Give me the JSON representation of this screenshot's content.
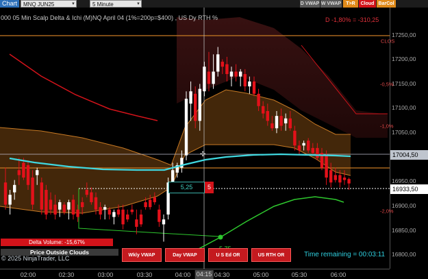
{
  "toolbar": {
    "chart_tab": "Chart",
    "instrument": "MNQ JUN25",
    "interval": "5 Minute",
    "buttons": [
      {
        "label": "D VWAP",
        "color": "#5a5a5a"
      },
      {
        "label": "W VWAP",
        "color": "#5a5a5a"
      },
      {
        "label": "T>R",
        "color": "#e08a1a"
      },
      {
        "label": "Cloud",
        "color": "#d3131a"
      },
      {
        "label": "BarCol",
        "color": "#e08a1a"
      }
    ]
  },
  "chart": {
    "title": "000 05 Min Scalp Delta & Ichi (M)NQ  April 04 (1%=200p=$400) , US Dy RTH %",
    "percent_summary": "D -1,80% = -310,25",
    "clos_label": "CLOS",
    "delta_volume": "Delta Volume: -15,67%",
    "price_outside_clouds": "Price Outside Clouds",
    "copyright": "© 2025 NinjaTrader, LLC",
    "vwap_buttons": [
      "Wkly VWAP",
      "Day VWAP",
      "U S Ed OR",
      "US RTH OR"
    ],
    "time_remaining": "Time remaining = 00:03:11",
    "cursor_value": "5,25",
    "cursor_count": "5",
    "green_line_label": "5,75",
    "colors": {
      "up": "#ffffff",
      "down": "#e3111a",
      "cloud": "#c87a24",
      "vwap": "#40d8e0",
      "ma_red": "#d3131a",
      "ma_green": "#2ec82e"
    }
  },
  "price_axis": {
    "labels": [
      "17250,00",
      "17200,00",
      "17150,00",
      "17100,00",
      "17050,00",
      "16950,00",
      "16900,00",
      "16850,00",
      "16800,00"
    ],
    "current_price": "16933,50",
    "cloud_price": "17004,50",
    "pct_labels": [
      "-0,5%",
      "-1,0%",
      "-2,0%"
    ]
  },
  "time_axis": {
    "labels": [
      "02:00",
      "02:30",
      "03:00",
      "03:30",
      "04:00",
      "04:30",
      "05:00",
      "05:30",
      "06:00"
    ],
    "cursor_time": "04:15"
  },
  "chart_data": {
    "type": "candlestick",
    "price_ylim": [
      16760,
      17290
    ],
    "candles": [
      {
        "o": 16935,
        "h": 16965,
        "l": 16880,
        "c": 16890
      },
      {
        "o": 16890,
        "h": 16920,
        "l": 16870,
        "c": 16910
      },
      {
        "o": 16915,
        "h": 16940,
        "l": 16900,
        "c": 16930
      },
      {
        "o": 16960,
        "h": 16985,
        "l": 16930,
        "c": 16950
      },
      {
        "o": 16975,
        "h": 16985,
        "l": 16940,
        "c": 16945
      },
      {
        "o": 16970,
        "h": 16980,
        "l": 16920,
        "c": 16930
      },
      {
        "o": 16945,
        "h": 16960,
        "l": 16880,
        "c": 16890
      },
      {
        "o": 16950,
        "h": 16965,
        "l": 16930,
        "c": 16960
      },
      {
        "o": 16935,
        "h": 16945,
        "l": 16870,
        "c": 16880
      },
      {
        "o": 16920,
        "h": 16930,
        "l": 16860,
        "c": 16870
      },
      {
        "o": 16900,
        "h": 16915,
        "l": 16870,
        "c": 16880
      },
      {
        "o": 16890,
        "h": 16910,
        "l": 16860,
        "c": 16870
      },
      {
        "o": 16880,
        "h": 16900,
        "l": 16865,
        "c": 16895
      },
      {
        "o": 16890,
        "h": 16895,
        "l": 16870,
        "c": 16875
      },
      {
        "o": 16880,
        "h": 16900,
        "l": 16860,
        "c": 16895
      },
      {
        "o": 16900,
        "h": 16910,
        "l": 16860,
        "c": 16870
      },
      {
        "o": 16880,
        "h": 16890,
        "l": 16855,
        "c": 16865
      },
      {
        "o": 16895,
        "h": 16905,
        "l": 16870,
        "c": 16885
      },
      {
        "o": 16920,
        "h": 16935,
        "l": 16905,
        "c": 16910
      },
      {
        "o": 16915,
        "h": 16925,
        "l": 16890,
        "c": 16895
      },
      {
        "o": 16905,
        "h": 16915,
        "l": 16870,
        "c": 16880
      },
      {
        "o": 16885,
        "h": 16895,
        "l": 16860,
        "c": 16870
      },
      {
        "o": 16880,
        "h": 16890,
        "l": 16860,
        "c": 16885
      },
      {
        "o": 16880,
        "h": 16885,
        "l": 16860,
        "c": 16870
      },
      {
        "o": 16865,
        "h": 16880,
        "l": 16850,
        "c": 16875
      },
      {
        "o": 16880,
        "h": 16890,
        "l": 16865,
        "c": 16870
      },
      {
        "o": 16880,
        "h": 16890,
        "l": 16840,
        "c": 16850
      },
      {
        "o": 16870,
        "h": 16880,
        "l": 16855,
        "c": 16860
      },
      {
        "o": 16880,
        "h": 16890,
        "l": 16870,
        "c": 16875
      },
      {
        "o": 16860,
        "h": 16880,
        "l": 16830,
        "c": 16845
      },
      {
        "o": 16870,
        "h": 16880,
        "l": 16845,
        "c": 16850
      },
      {
        "o": 16895,
        "h": 16905,
        "l": 16880,
        "c": 16885
      },
      {
        "o": 16900,
        "h": 16910,
        "l": 16880,
        "c": 16885
      },
      {
        "o": 16905,
        "h": 16915,
        "l": 16890,
        "c": 16895
      },
      {
        "o": 16880,
        "h": 16890,
        "l": 16845,
        "c": 16855
      },
      {
        "o": 16850,
        "h": 16870,
        "l": 16815,
        "c": 16860
      },
      {
        "o": 16870,
        "h": 16945,
        "l": 16860,
        "c": 16935
      },
      {
        "o": 16935,
        "h": 16975,
        "l": 16925,
        "c": 16960
      },
      {
        "o": 16955,
        "h": 16975,
        "l": 16945,
        "c": 16970
      },
      {
        "o": 16965,
        "h": 17000,
        "l": 16955,
        "c": 16985
      },
      {
        "o": 16990,
        "h": 17120,
        "l": 16980,
        "c": 17105
      },
      {
        "o": 17095,
        "h": 17140,
        "l": 17060,
        "c": 17120
      },
      {
        "o": 17115,
        "h": 17130,
        "l": 17045,
        "c": 17060
      },
      {
        "o": 17060,
        "h": 17135,
        "l": 17040,
        "c": 17125
      },
      {
        "o": 17120,
        "h": 17180,
        "l": 17110,
        "c": 17170
      },
      {
        "o": 17160,
        "h": 17200,
        "l": 17120,
        "c": 17135
      },
      {
        "o": 17135,
        "h": 17195,
        "l": 17125,
        "c": 17160
      },
      {
        "o": 17160,
        "h": 17210,
        "l": 17150,
        "c": 17195
      },
      {
        "o": 17180,
        "h": 17185,
        "l": 17155,
        "c": 17170
      },
      {
        "o": 17175,
        "h": 17190,
        "l": 17140,
        "c": 17155
      },
      {
        "o": 17150,
        "h": 17170,
        "l": 17130,
        "c": 17160
      },
      {
        "o": 17160,
        "h": 17175,
        "l": 17140,
        "c": 17150
      },
      {
        "o": 17150,
        "h": 17165,
        "l": 17130,
        "c": 17160
      },
      {
        "o": 17155,
        "h": 17165,
        "l": 17120,
        "c": 17130
      },
      {
        "o": 17130,
        "h": 17150,
        "l": 17115,
        "c": 17140
      },
      {
        "o": 17140,
        "h": 17150,
        "l": 17110,
        "c": 17115
      },
      {
        "o": 17115,
        "h": 17125,
        "l": 17080,
        "c": 17090
      },
      {
        "o": 17090,
        "h": 17100,
        "l": 17065,
        "c": 17075
      },
      {
        "o": 17080,
        "h": 17095,
        "l": 17050,
        "c": 17060
      },
      {
        "o": 17055,
        "h": 17070,
        "l": 17040,
        "c": 17045
      },
      {
        "o": 17045,
        "h": 17080,
        "l": 17035,
        "c": 17070
      },
      {
        "o": 17070,
        "h": 17085,
        "l": 17040,
        "c": 17050
      },
      {
        "o": 17055,
        "h": 17075,
        "l": 17040,
        "c": 17065
      },
      {
        "o": 17065,
        "h": 17080,
        "l": 17040,
        "c": 17045
      },
      {
        "o": 17040,
        "h": 17050,
        "l": 17000,
        "c": 17010
      },
      {
        "o": 17010,
        "h": 17020,
        "l": 16990,
        "c": 17000
      },
      {
        "o": 17010,
        "h": 17020,
        "l": 17000,
        "c": 17015
      },
      {
        "o": 17020,
        "h": 17025,
        "l": 16995,
        "c": 17000
      },
      {
        "o": 17005,
        "h": 17015,
        "l": 16990,
        "c": 16995
      },
      {
        "o": 17005,
        "h": 17015,
        "l": 16980,
        "c": 16985
      },
      {
        "o": 16995,
        "h": 17005,
        "l": 16960,
        "c": 16965
      },
      {
        "o": 16990,
        "h": 17000,
        "l": 16930,
        "c": 16945
      },
      {
        "o": 16960,
        "h": 16975,
        "l": 16925,
        "c": 16935
      },
      {
        "o": 16950,
        "h": 16965,
        "l": 16935,
        "c": 16940
      },
      {
        "o": 16950,
        "h": 16960,
        "l": 16925,
        "c": 16935
      },
      {
        "o": 16945,
        "h": 16960,
        "l": 16930,
        "c": 16940
      },
      {
        "o": 16942,
        "h": 16945,
        "l": 16920,
        "c": 16933
      }
    ]
  }
}
